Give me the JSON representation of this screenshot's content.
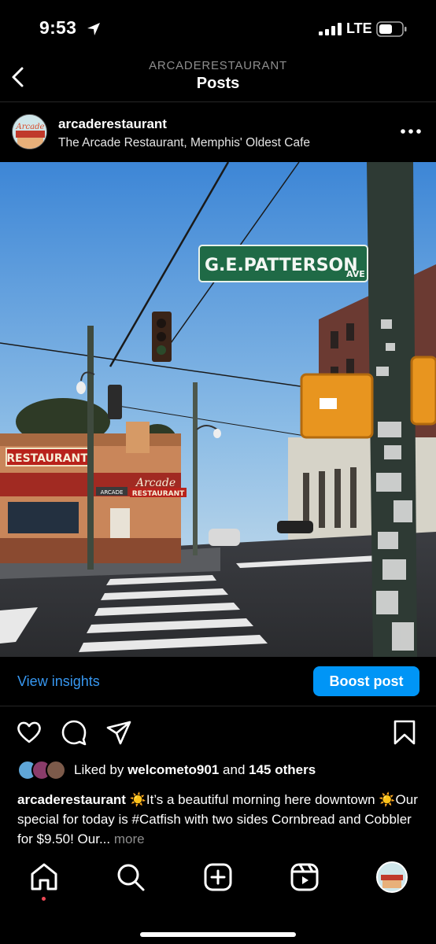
{
  "status": {
    "time": "9:53",
    "network": "LTE",
    "icons": [
      "location-arrow-icon",
      "signal-icon",
      "battery-icon"
    ]
  },
  "header": {
    "owner": "ARCADERESTAURANT",
    "title": "Posts",
    "back_icon": "chevron-left-icon"
  },
  "post": {
    "username": "arcaderestaurant",
    "location": "The Arcade Restaurant, Memphis' Oldest Cafe",
    "more_icon": "more-horizontal-icon",
    "photo": {
      "street_sign": "G.E.PATTERSON",
      "street_sign_suffix": "AVE",
      "roof_sign": "RESTAURANT",
      "awning_script": "Arcade",
      "awning_sign": "RESTAURANT",
      "side_sign": "ARCADE"
    }
  },
  "insights": {
    "view_label": "View insights",
    "boost_label": "Boost post"
  },
  "actions": {
    "icons": [
      "heart-icon",
      "comment-icon",
      "share-icon",
      "bookmark-icon"
    ]
  },
  "likes": {
    "prefix": "Liked by",
    "liker": "welcometo901",
    "joiner": "and",
    "others": "145 others"
  },
  "caption": {
    "username": "arcaderestaurant",
    "text": "☀️It’s a beautiful morning here downtown ☀️Our special for today is #Catfish with two sides Cornbread and Cobbler for $9.50! Our...",
    "more": "more"
  },
  "nav": {
    "items": [
      "home-icon",
      "search-icon",
      "create-icon",
      "reels-icon",
      "profile-avatar"
    ],
    "colors": {
      "notification_dot": "#ed4956"
    }
  },
  "colors": {
    "background": "#000000",
    "link": "#3797f0",
    "boost_button": "#0095f6",
    "secondary_text": "#8e8e8e"
  }
}
